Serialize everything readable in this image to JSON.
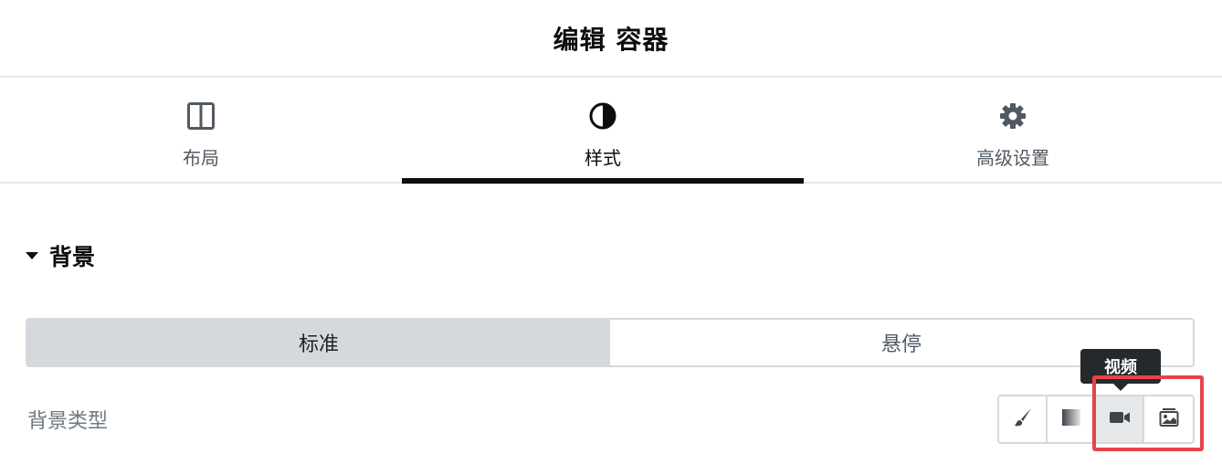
{
  "header": {
    "title": "编辑 容器"
  },
  "tabs": [
    {
      "label": "布局",
      "icon": "columns-icon",
      "active": false
    },
    {
      "label": "样式",
      "icon": "half-circle-icon",
      "active": true
    },
    {
      "label": "高级设置",
      "icon": "gear-icon",
      "active": false
    }
  ],
  "section": {
    "title": "背景"
  },
  "state_switcher": {
    "normal_label": "标准",
    "hover_label": "悬停",
    "selected": "标准"
  },
  "background_type": {
    "label": "背景类型",
    "options": [
      {
        "name": "brush-icon"
      },
      {
        "name": "gradient-icon"
      },
      {
        "name": "video-icon"
      },
      {
        "name": "slideshow-icon"
      }
    ],
    "tooltip": "视频"
  },
  "colors": {
    "highlight": "#e8434b",
    "tab_indicator": "#0c0d0e",
    "tooltip_bg": "#26292c"
  }
}
